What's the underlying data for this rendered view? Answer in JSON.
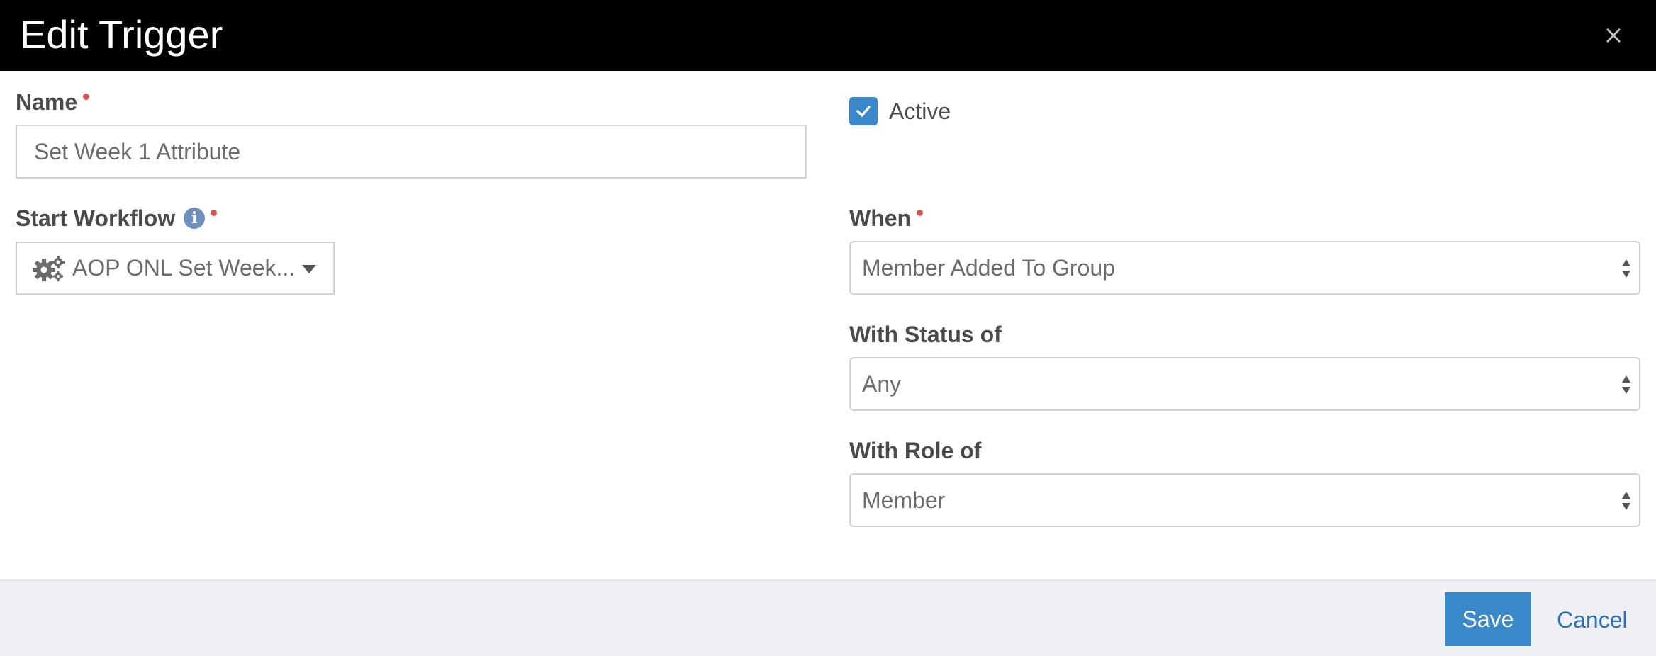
{
  "modal": {
    "title": "Edit Trigger",
    "close_glyph": "×"
  },
  "name_field": {
    "label": "Name",
    "value": "Set Week 1 Attribute"
  },
  "active": {
    "label": "Active",
    "checked": true
  },
  "workflow": {
    "label": "Start Workflow",
    "value": "AOP ONL Set Week..."
  },
  "when": {
    "label": "When",
    "value": "Member Added To Group"
  },
  "status": {
    "label": "With Status of",
    "value": "Any"
  },
  "role": {
    "label": "With Role of",
    "value": "Member"
  },
  "footer": {
    "save_label": "Save",
    "cancel_label": "Cancel"
  },
  "colors": {
    "header": "#000000",
    "accent": "#3a87c9",
    "required": "#d9534f",
    "info": "#6f8fbe",
    "link": "#2f6fb5"
  },
  "icons": [
    "close-icon",
    "required-indicator",
    "info-icon",
    "gears-icon",
    "caret-down-icon",
    "sort-arrows-icon",
    "check-icon"
  ]
}
